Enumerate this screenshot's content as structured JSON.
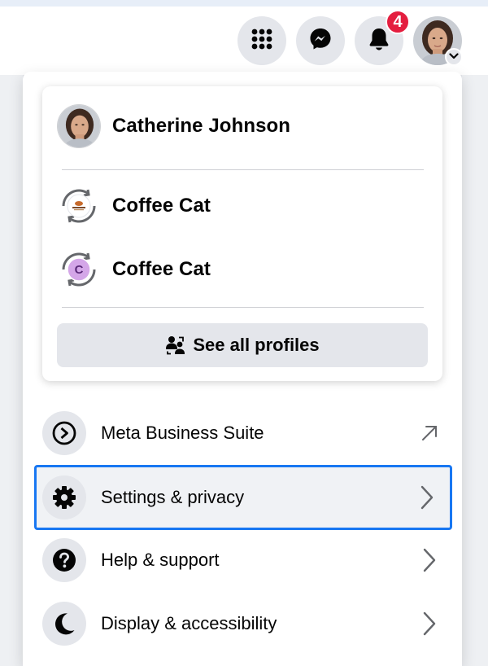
{
  "header": {
    "menu_icon": "grid-icon",
    "messenger_icon": "messenger-icon",
    "notifications_icon": "bell-icon",
    "notification_count": "4",
    "account_avatar": "profile-photo",
    "account_caret_icon": "chevron-down-icon"
  },
  "profiles": {
    "main_profile": {
      "name": "Catherine Johnson"
    },
    "pages": [
      {
        "name": "Coffee Cat",
        "avatar": "coffee-logo"
      },
      {
        "name": "Coffee Cat",
        "avatar": "letter-avatar",
        "initial": "C"
      }
    ],
    "see_all_label": "See all profiles"
  },
  "menu": {
    "items": [
      {
        "label": "Meta Business Suite",
        "icon": "meta-business-icon",
        "trailing": "external-arrow-icon"
      },
      {
        "label": "Settings & privacy",
        "icon": "gear-icon",
        "trailing": "chevron-right-icon"
      },
      {
        "label": "Help & support",
        "icon": "question-icon",
        "trailing": "chevron-right-icon"
      },
      {
        "label": "Display & accessibility",
        "icon": "moon-icon",
        "trailing": "chevron-right-icon"
      }
    ]
  },
  "colors": {
    "focus_outline": "#1877f2",
    "badge": "#e41e3f",
    "letter_avatar": "#d4a6e8"
  }
}
